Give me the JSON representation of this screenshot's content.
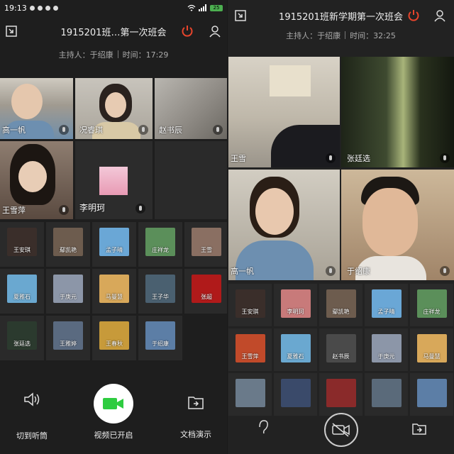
{
  "left": {
    "status": {
      "time": "19:13",
      "battery": "25"
    },
    "title": "1915201班…第一次班会",
    "host_label": "主持人：于绍康",
    "time_label": "时间：17:29",
    "video_tiles": [
      {
        "name": "高一帆",
        "bg": "#8b8a86"
      },
      {
        "name": "况睿琪",
        "bg": "#a8a49a"
      },
      {
        "name": "赵书辰",
        "bg": "#9a9590"
      },
      {
        "name": "王雪萍",
        "bg": "#6a5a50"
      }
    ],
    "avatar_tile": {
      "name": "李明珂"
    },
    "participants": [
      {
        "name": "王安琪",
        "color": "#3a2e2a"
      },
      {
        "name": "鄢凯艳",
        "color": "#6d5c4e"
      },
      {
        "name": "孟子晴",
        "color": "#6aa7d6"
      },
      {
        "name": "庄祥龙",
        "color": "#5b8f5a"
      },
      {
        "name": "王雪",
        "color": "#8a6f62"
      },
      {
        "name": "夏雅石",
        "color": "#6aa8d0"
      },
      {
        "name": "于庚元",
        "color": "#8c96a8"
      },
      {
        "name": "马曼慧",
        "color": "#d8a85a"
      },
      {
        "name": "王子华",
        "color": "#4a6070"
      },
      {
        "name": "张超",
        "color": "#b01a1a"
      },
      {
        "name": "张廷选",
        "color": "#2b3a2e"
      },
      {
        "name": "王雅婷",
        "color": "#5a6a80"
      },
      {
        "name": "王春秋",
        "color": "#c79a3a"
      },
      {
        "name": "于绍康",
        "color": "#5c7ea6"
      }
    ],
    "controls": {
      "earpiece": "切到听筒",
      "video": "视频已开启",
      "doc": "文档演示"
    }
  },
  "right": {
    "title": "1915201班新学期第一次班会",
    "host_label": "主持人：于绍康",
    "time_label": "时间：32:25",
    "video_tiles": [
      {
        "name": "王雪",
        "bg": "#b0aca2"
      },
      {
        "name": "张廷选",
        "bg": "#2e3a24"
      },
      {
        "name": "高一帆",
        "bg": "#8e8a80"
      },
      {
        "name": "于绍康",
        "bg": "#b7a28a"
      }
    ],
    "participants": [
      {
        "name": "王安琪",
        "color": "#3a2e2a"
      },
      {
        "name": "李明珂",
        "color": "#c87a7a"
      },
      {
        "name": "鄢凯艳",
        "color": "#6d5c4e"
      },
      {
        "name": "孟子晴",
        "color": "#6aa7d6"
      },
      {
        "name": "庄祥龙",
        "color": "#5b8f5a"
      },
      {
        "name": "王雪萍",
        "color": "#c14a2a"
      },
      {
        "name": "夏雅石",
        "color": "#6aa8d0"
      },
      {
        "name": "赵书辰",
        "color": "#4a4a4a"
      },
      {
        "name": "于庚元",
        "color": "#8c96a8"
      },
      {
        "name": "马曼慧",
        "color": "#d8a85a"
      },
      {
        "name": "",
        "color": "#6a7a8a"
      },
      {
        "name": "",
        "color": "#3a4a6a"
      },
      {
        "name": "",
        "color": "#8a2a2a"
      },
      {
        "name": "",
        "color": "#5a6a7a"
      },
      {
        "name": "",
        "color": "#5c7ea6"
      }
    ]
  },
  "colors": {
    "accent_red": "#e8452c",
    "video_green": "#2ecc40",
    "panel_bg": "#1e1e1e"
  }
}
